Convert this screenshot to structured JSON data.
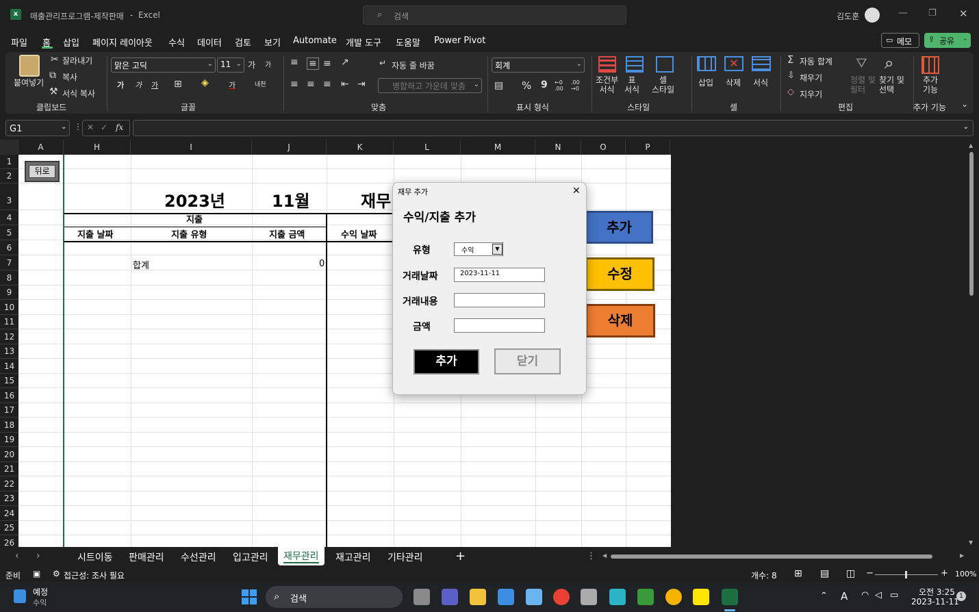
{
  "titlebar": {
    "file_name": "매출관리프로그램-제작판매",
    "separator": "-",
    "app_name": "Excel",
    "search_placeholder": "검색",
    "user_name": "김도훈"
  },
  "menu": {
    "items": [
      "파일",
      "홈",
      "삽입",
      "페이지 레이아웃",
      "수식",
      "데이터",
      "검토",
      "보기",
      "Automate",
      "개발 도구",
      "도움말",
      "Power Pivot"
    ],
    "active": "홈",
    "memo_label": "메모",
    "share_label": "공유"
  },
  "ribbon": {
    "clipboard": {
      "paste": "붙여넣기",
      "cut": "잘라내기",
      "copy": "복사",
      "format_painter": "서식 복사",
      "group": "클립보드"
    },
    "font": {
      "name": "맑은 고딕",
      "size": "11",
      "group": "글꼴",
      "grow": "가",
      "shrink": "가",
      "bold": "가",
      "italic": "가",
      "underline": "가",
      "phonetic": "내천"
    },
    "align": {
      "wrap": "자동 줄 바꿈",
      "merge": "병합하고 가운데 맞춤",
      "group": "맞춤"
    },
    "number": {
      "format": "회계",
      "percent": "%",
      "comma": "9",
      "inc": "←0 .00",
      "dec": ".00 →0",
      "group": "표시 형식"
    },
    "styles": {
      "conditional": "조건부\n서식",
      "table": "표\n서식",
      "cell": "셀\n스타일",
      "group": "스타일"
    },
    "cells": {
      "insert": "삽입",
      "delete": "삭제",
      "format": "서식",
      "group": "셀"
    },
    "editing": {
      "autosum": "자동 합계",
      "fill": "채우기",
      "clear": "지우기",
      "sort": "정렬 및\n필터",
      "find": "찾기 및\n선택",
      "group": "편집"
    },
    "addins": {
      "label": "추가\n기능",
      "group": "추가 기능"
    }
  },
  "formulabar": {
    "name_box": "G1",
    "fx": "fx",
    "value": ""
  },
  "columns": [
    "A",
    "H",
    "I",
    "J",
    "K",
    "L",
    "M",
    "N",
    "O",
    "P"
  ],
  "rows": [
    "1",
    "2",
    "3",
    "4",
    "5",
    "6",
    "7",
    "8",
    "9",
    "10",
    "11",
    "12",
    "13",
    "14",
    "15",
    "16",
    "17",
    "18",
    "19",
    "20",
    "21",
    "22",
    "23",
    "24",
    "25",
    "26"
  ],
  "sheet": {
    "back_button": "뒤로",
    "year": "2023년",
    "month": "11월",
    "title_partial": "재무",
    "expense_header": "지출",
    "col_expense_date": "지출 날짜",
    "col_expense_type": "지출 유형",
    "col_expense_amount": "지출 금액",
    "col_income_date": "수익 날짜",
    "total_label": "합계",
    "total_value": "0",
    "btn_add": "추가",
    "btn_edit": "수정",
    "btn_delete": "삭제"
  },
  "dialog": {
    "title": "재무 추가",
    "heading": "수익/지출 추가",
    "type_label": "유형",
    "type_value": "수익",
    "date_label": "거래날짜",
    "date_value": "2023-11-11",
    "desc_label": "거래내용",
    "desc_value": "",
    "amount_label": "금액",
    "amount_value": "",
    "add_button": "추가",
    "close_button": "닫기"
  },
  "tabs": {
    "items": [
      "시트이동",
      "판매관리",
      "수선관리",
      "입고관리",
      "재무관리",
      "재고관리",
      "기타관리"
    ],
    "active": "재무관리",
    "add": "+"
  },
  "status": {
    "ready": "준비",
    "accessibility": "접근성: 조사 필요",
    "count": "개수: 8",
    "zoom": "100%"
  },
  "taskbar": {
    "weather_title": "예정",
    "weather_sub": "수익",
    "search": "검색",
    "time": "오전 3:25",
    "date": "2023-11-11",
    "notif": "1"
  },
  "colors": {
    "add_btn": "#4472c4",
    "edit_btn": "#ffc000",
    "delete_btn": "#ed7d31",
    "excel_green": "#1d6f42"
  }
}
